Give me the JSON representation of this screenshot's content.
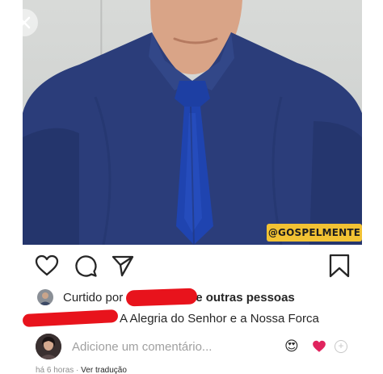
{
  "overlay": {
    "close_icon": "close-icon"
  },
  "post": {
    "watermark": "@GOSPELMENTE"
  },
  "actions": {
    "like_icon": "heart-outline-icon",
    "comment_icon": "comment-bubble-icon",
    "share_icon": "paper-plane-icon",
    "save_icon": "bookmark-icon"
  },
  "likes": {
    "prefix": "Curtido por",
    "suffix": "e outras pessoas"
  },
  "caption": {
    "text": "A Alegria do Senhor e a Nossa Forca"
  },
  "comment_box": {
    "placeholder": "Adicione um comentário...",
    "emoji_1": "😍",
    "emoji_2": "❤️",
    "add_icon": "plus-circle-icon"
  },
  "meta": {
    "time": "há 6 horas",
    "separator": "·",
    "translate": "Ver tradução"
  },
  "colors": {
    "shirt": "#2b3d7a",
    "tie": "#1d3fa3",
    "redaction": "#e8131c",
    "watermark_bg": "#f2c233"
  }
}
